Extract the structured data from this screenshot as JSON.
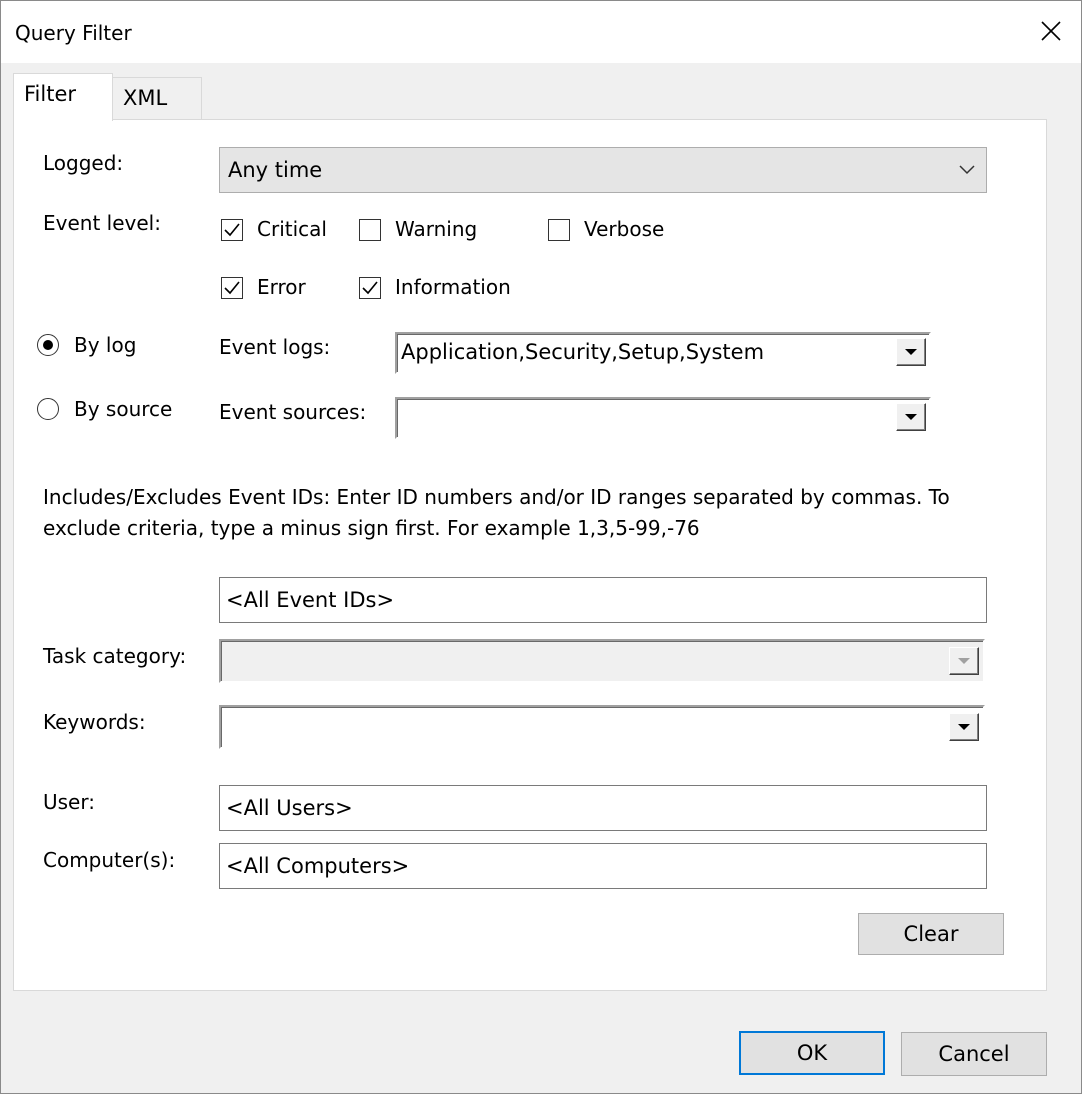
{
  "window": {
    "title": "Query Filter"
  },
  "tabs": [
    {
      "label": "Filter",
      "active": true
    },
    {
      "label": "XML",
      "active": false
    }
  ],
  "logged": {
    "label": "Logged:",
    "value": "Any time"
  },
  "event_level": {
    "label": "Event level:",
    "options": [
      {
        "label": "Critical",
        "checked": true
      },
      {
        "label": "Warning",
        "checked": false
      },
      {
        "label": "Verbose",
        "checked": false
      },
      {
        "label": "Error",
        "checked": true
      },
      {
        "label": "Information",
        "checked": true
      }
    ]
  },
  "by_log": {
    "label": "By log",
    "selected": true
  },
  "by_source": {
    "label": "By source",
    "selected": false
  },
  "event_logs": {
    "label": "Event logs:",
    "value": "Application,Security,Setup,System"
  },
  "event_sources": {
    "label": "Event sources:",
    "value": ""
  },
  "help_text": "Includes/Excludes Event IDs: Enter ID numbers and/or ID ranges separated by commas. To exclude criteria, type a minus sign first. For example 1,3,5-99,-76",
  "event_ids": {
    "value": "<All Event IDs>"
  },
  "task_category": {
    "label": "Task category:",
    "value": ""
  },
  "keywords": {
    "label": "Keywords:",
    "value": ""
  },
  "user": {
    "label": "User:",
    "value": "<All Users>"
  },
  "computers": {
    "label": "Computer(s):",
    "value": "<All Computers>"
  },
  "buttons": {
    "clear": "Clear",
    "ok": "OK",
    "cancel": "Cancel"
  }
}
